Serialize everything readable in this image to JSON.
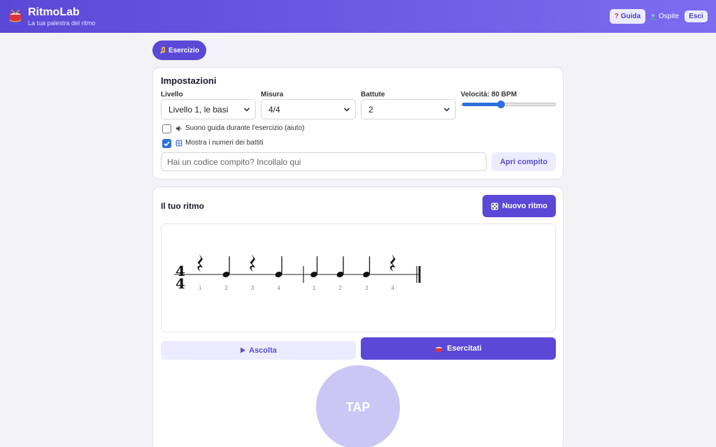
{
  "header": {
    "app_name": "RitmoLab",
    "tagline": "La tua palestra del ritmo",
    "guide_label": "Guida",
    "user_label": "Ospite",
    "exit_label": "Esci",
    "logo_icon": "drum-icon"
  },
  "tabs": [
    {
      "label": "Esercizio",
      "icon": "music-note-icon",
      "active": true
    }
  ],
  "settings": {
    "title": "Impostazioni",
    "level": {
      "label": "Livello",
      "value": "Livello 1, le basi"
    },
    "meter": {
      "label": "Misura",
      "value": "4/4"
    },
    "bars": {
      "label": "Battute",
      "value": "2"
    },
    "tempo": {
      "label": "Velocità: 80 BPM",
      "bpm": 80,
      "slider_fraction": 0.41
    },
    "guide_sound": {
      "label": "Suono guida durante l'esercizio (aiuto)",
      "checked": false
    },
    "show_beats": {
      "label": "Mostra i numeri dei battiti",
      "checked": true
    },
    "code_placeholder": "Hai un codice compito? Incollalo qui",
    "open_button": "Apri compito"
  },
  "rhythm": {
    "title": "Il tuo ritmo",
    "new_button": "Nuovo ritmo",
    "time_signature": {
      "top": "4",
      "bottom": "4"
    },
    "measures": [
      {
        "events": [
          {
            "type": "rest",
            "beat": "1"
          },
          {
            "type": "note",
            "beat": "2"
          },
          {
            "type": "rest",
            "beat": "3"
          },
          {
            "type": "note",
            "beat": "4"
          }
        ]
      },
      {
        "events": [
          {
            "type": "note",
            "beat": "1"
          },
          {
            "type": "note",
            "beat": "2"
          },
          {
            "type": "note",
            "beat": "3"
          },
          {
            "type": "rest",
            "beat": "4"
          }
        ]
      }
    ],
    "listen_button": "Ascolta",
    "practice_button": "Esercitati",
    "tap_label": "TAP"
  },
  "colors": {
    "primary": "#5b48d6",
    "light": "#ecebff",
    "tap": "#cbc6f4",
    "accent_blue": "#2d6fe0"
  }
}
